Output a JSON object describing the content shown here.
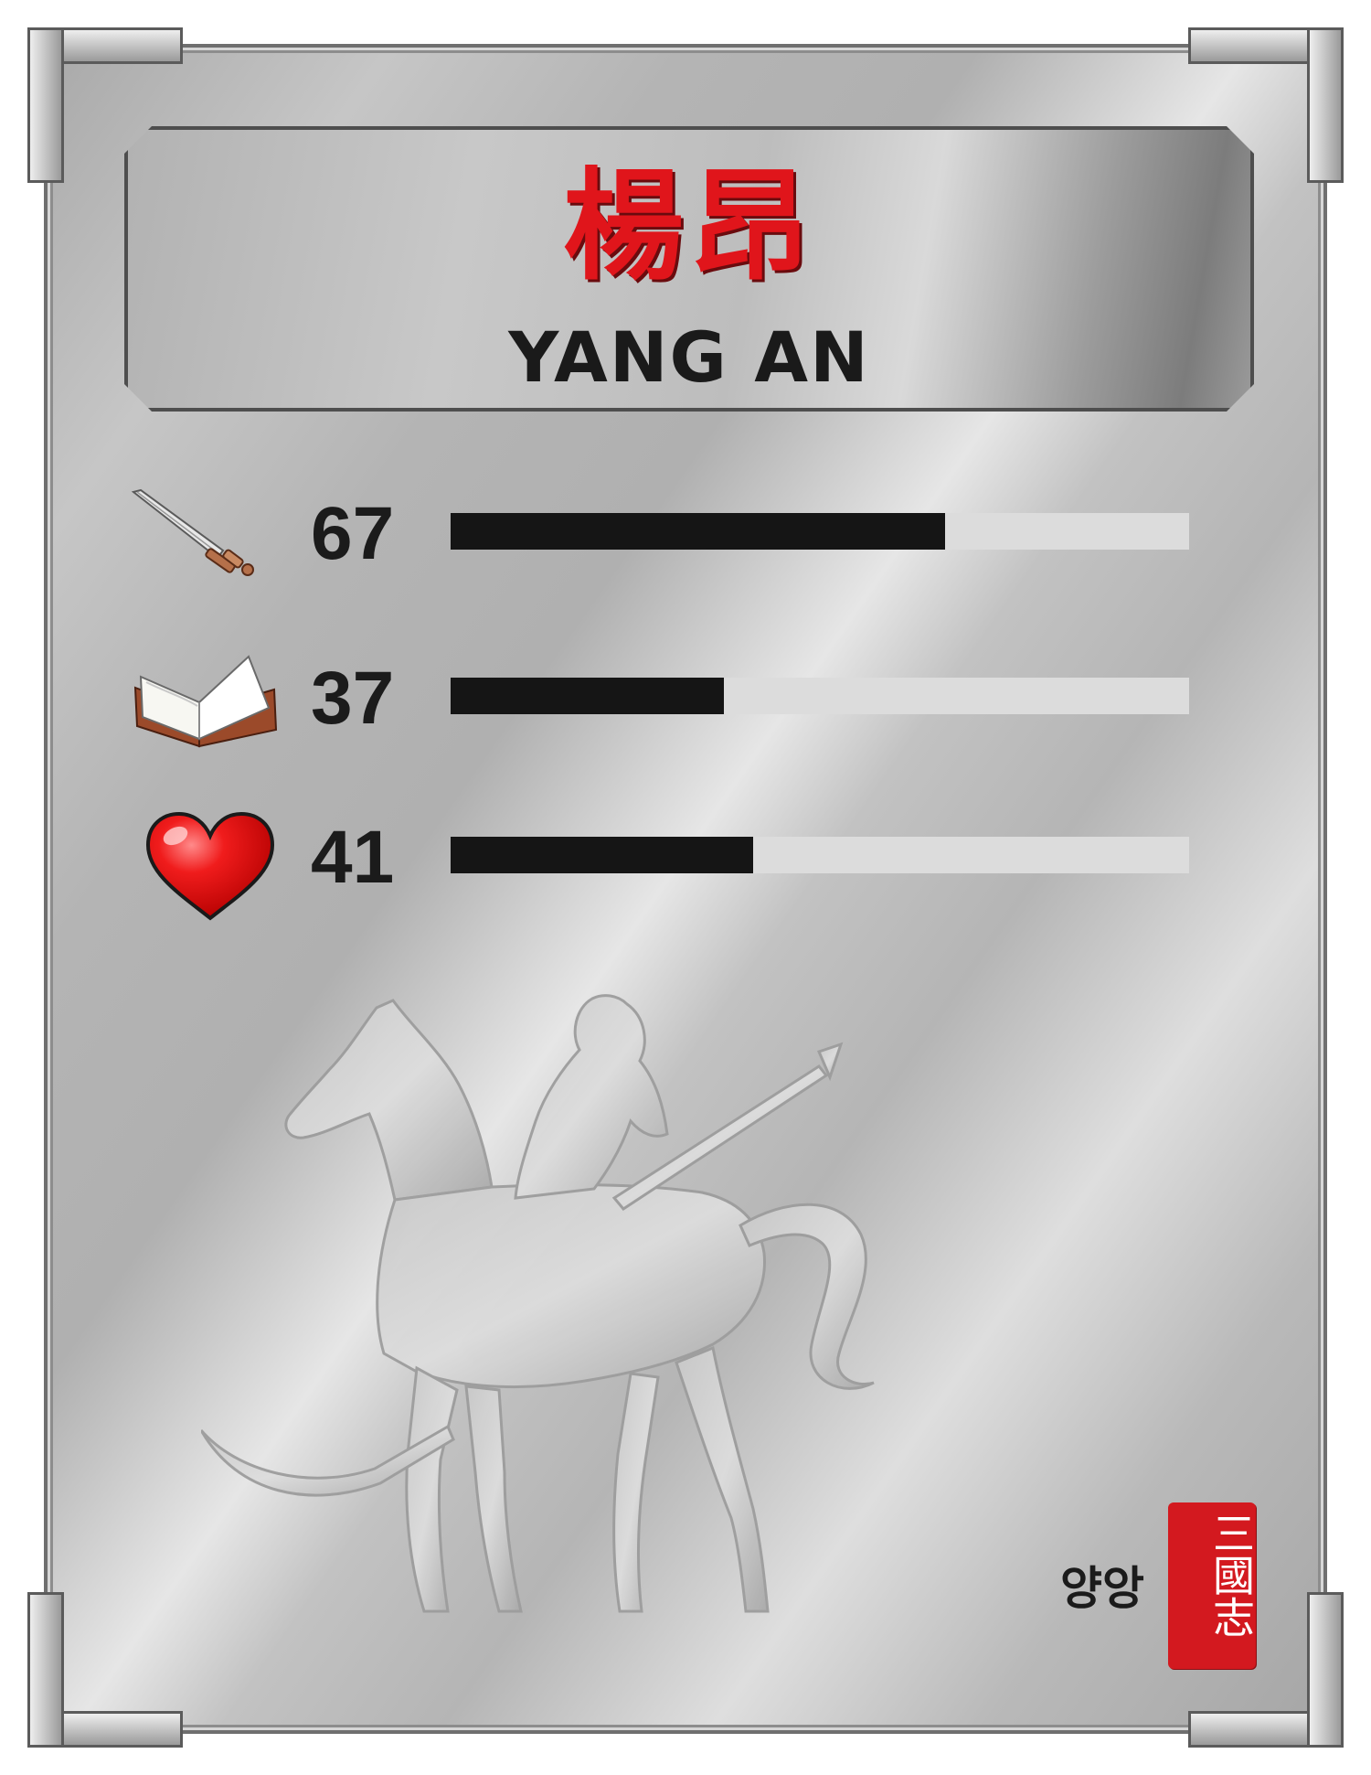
{
  "character": {
    "name_cn": "楊昂",
    "name_en": "YANG AN",
    "name_kr": "양앙"
  },
  "stats": [
    {
      "icon": "sword-icon",
      "value": "67",
      "fill": 0.67
    },
    {
      "icon": "book-icon",
      "value": "37",
      "fill": 0.37
    },
    {
      "icon": "heart-icon",
      "value": "41",
      "fill": 0.41
    }
  ],
  "seal": {
    "text": "三國志"
  },
  "colors": {
    "name_red": "#e0151b",
    "bar_fill": "#151515",
    "bar_track": "#dcdcdc",
    "seal_red": "#d3191f"
  }
}
